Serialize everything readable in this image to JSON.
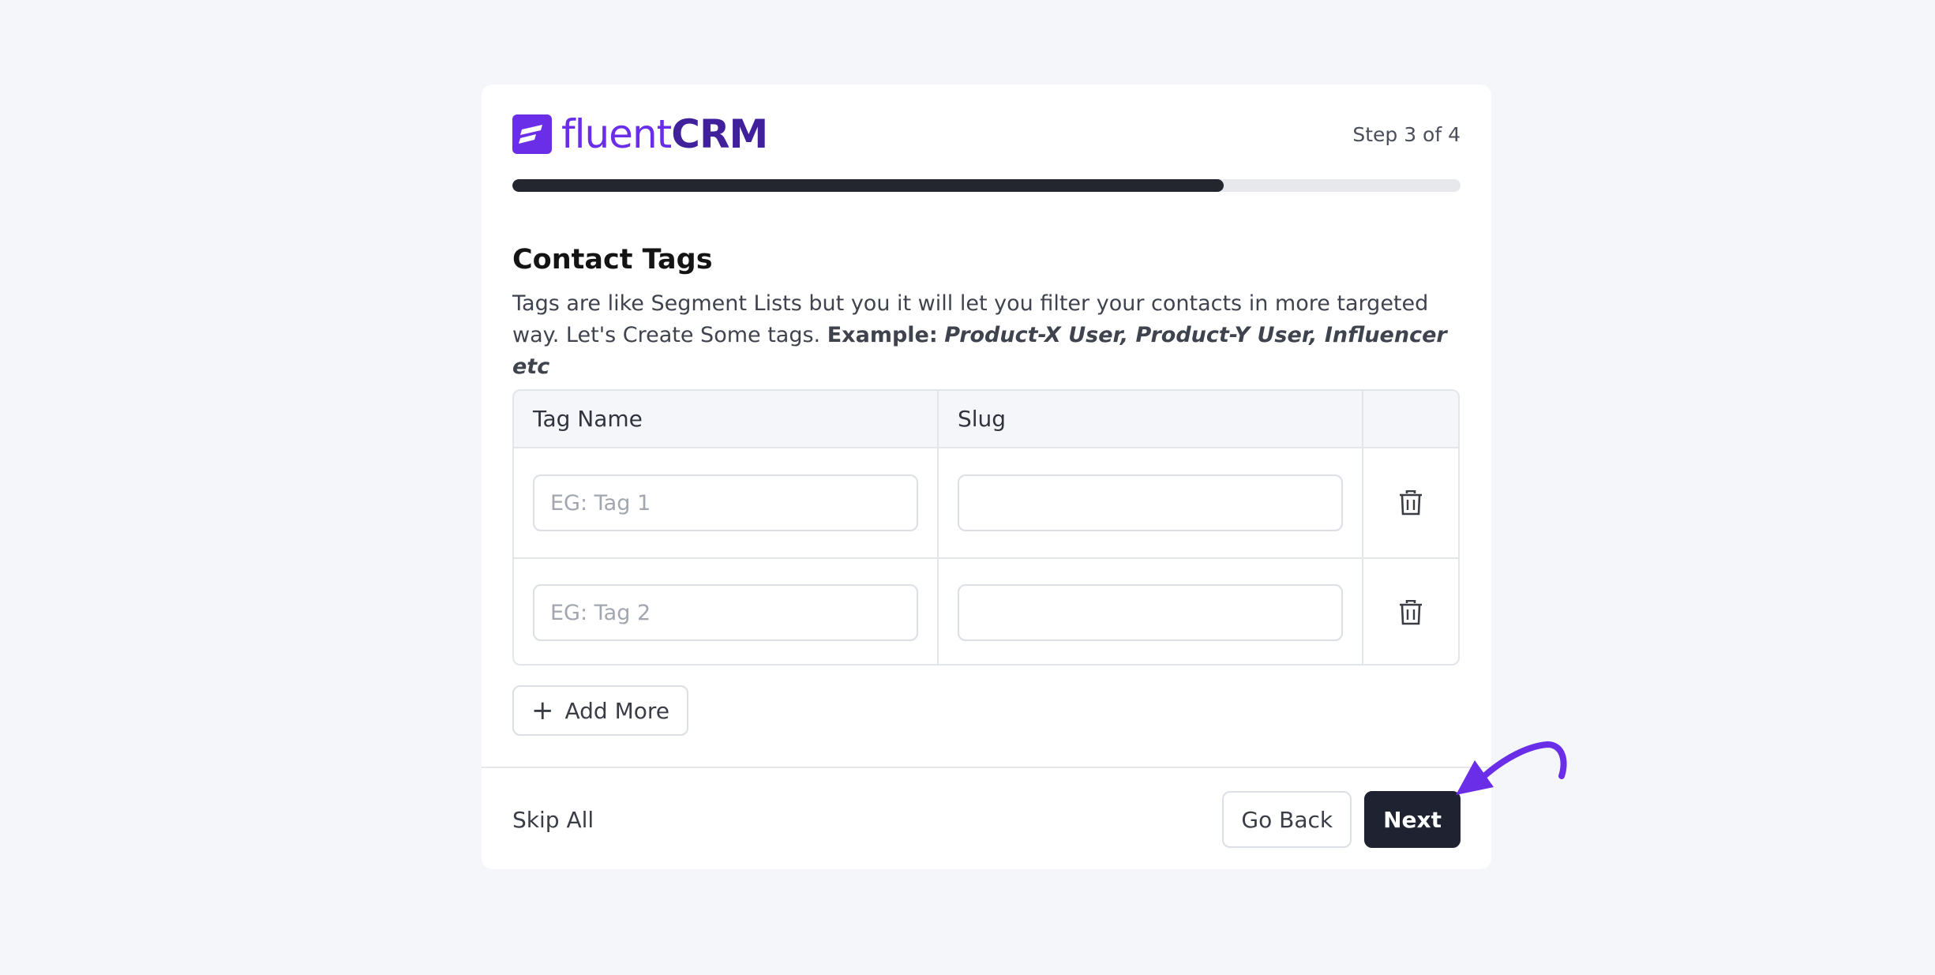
{
  "brand": {
    "name_light": "fluent",
    "name_bold": "CRM",
    "color": "#6b2ee8"
  },
  "step": {
    "label": "Step 3 of 4",
    "progress": 0.75
  },
  "section": {
    "title": "Contact Tags",
    "description": "Tags are like Segment Lists but you it will let you filter your contacts in more targeted way. Let's Create Some tags.",
    "example_label": "Example:",
    "example_text": "Product-X User, Product-Y User, Influencer etc"
  },
  "table": {
    "headers": [
      "Tag Name",
      "Slug",
      ""
    ],
    "rows": [
      {
        "name_placeholder": "EG: Tag 1",
        "name_value": "",
        "slug_value": ""
      },
      {
        "name_placeholder": "EG: Tag 2",
        "name_value": "",
        "slug_value": ""
      }
    ]
  },
  "actions": {
    "add_more": "Add More",
    "skip_all": "Skip All",
    "go_back": "Go Back",
    "next": "Next"
  },
  "icons": {
    "logo": "fluentcrm-logo-icon",
    "delete": "trash-icon",
    "add": "plus-icon",
    "annotation": "arrow-annotation-icon"
  },
  "colors": {
    "background": "#f4f6fa",
    "primary_dark": "#1f2230",
    "annotation": "#6b2ee8"
  }
}
